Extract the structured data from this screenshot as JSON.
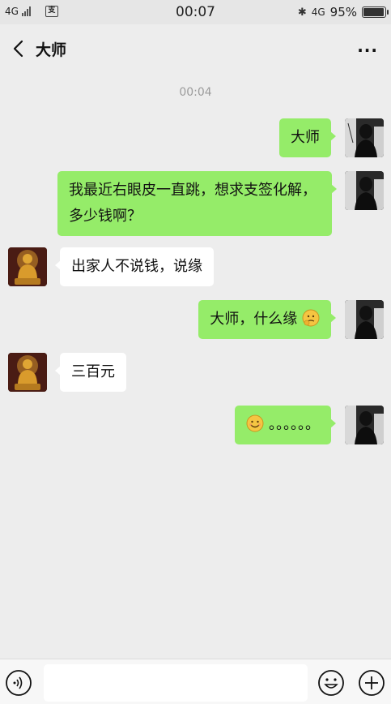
{
  "status_bar": {
    "network_left": "4G",
    "app_icon": "app-icon",
    "time": "00:07",
    "bluetooth_icon": "bluetooth-icon",
    "network_right": "4G",
    "battery": "95%",
    "battery_level": 0.95
  },
  "navbar": {
    "back_icon": "chevron-left-icon",
    "title": "大师",
    "more_label": "···"
  },
  "chat": {
    "timestamp": "00:04",
    "messages": [
      {
        "sender": "me",
        "text": "大师"
      },
      {
        "sender": "me",
        "text": "我最近右眼皮一直跳，想求支签化解，多少钱啊？"
      },
      {
        "sender": "master",
        "text": "出家人不说钱，说缘"
      },
      {
        "sender": "me",
        "text": "大师，什么缘",
        "emoji": "thinking-face-emoji"
      },
      {
        "sender": "master",
        "text": "三百元"
      },
      {
        "sender": "me",
        "text": "。。。。。。",
        "emoji": "smile-emoji"
      }
    ]
  },
  "input_bar": {
    "voice_icon": "voice-icon",
    "input_value": "",
    "emoji_icon": "emoji-icon",
    "plus_icon": "plus-icon"
  },
  "colors": {
    "my_bubble": "#95ec69",
    "master_bubble": "#ffffff",
    "background": "#ededed"
  }
}
